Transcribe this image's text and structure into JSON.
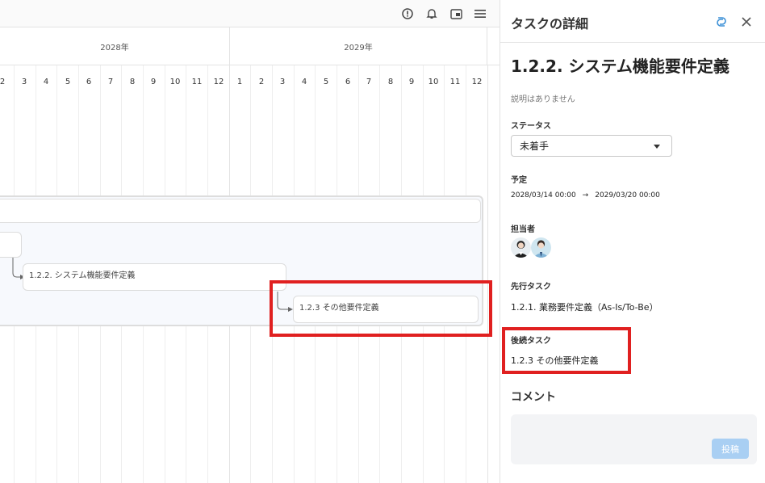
{
  "toolbar": {
    "icons": [
      "info-icon",
      "bell-icon",
      "picture-in-picture-icon",
      "menu-icon"
    ]
  },
  "timeline": {
    "years": [
      "2028年",
      "2029年"
    ],
    "months": [
      "2",
      "3",
      "4",
      "5",
      "6",
      "7",
      "8",
      "9",
      "10",
      "11",
      "12",
      "1",
      "2",
      "3",
      "4",
      "5",
      "6",
      "7",
      "8",
      "9",
      "10",
      "11",
      "12"
    ]
  },
  "tasks": {
    "task_122": "1.2.2. システム機能要件定義",
    "task_123": "1.2.3 その他要件定義"
  },
  "panel": {
    "title": "タスクの詳細",
    "task_title": "1.2.2. システム機能要件定義",
    "description": "説明はありません",
    "status_label": "ステータス",
    "status_value": "未着手",
    "schedule_label": "予定",
    "start": "2028/03/14 00:00",
    "arrow": "→",
    "end": "2029/03/20 00:00",
    "assignee_label": "担当者",
    "predecessor_label": "先行タスク",
    "predecessor_value": "1.2.1. 業務要件定義（As-Is/To-Be）",
    "successor_label": "後続タスク",
    "successor_value": "1.2.3 その他要件定義",
    "comment_label": "コメント",
    "post_label": "投稿"
  },
  "colors": {
    "highlight": "#e02020",
    "post_button": "#a9cff3",
    "accent_icon": "#3a8fd6"
  }
}
